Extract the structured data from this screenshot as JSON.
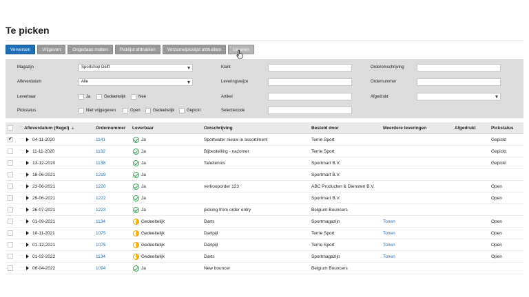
{
  "page": {
    "title": "Te picken"
  },
  "toolbar": {
    "buttons": [
      {
        "label": "Verversen"
      },
      {
        "label": "Vrijgeven"
      },
      {
        "label": "Ongedaan maken"
      },
      {
        "label": "Picklijst afdrukken"
      },
      {
        "label": "Verzamelpicklijst afdrukken"
      },
      {
        "label": "Leveren"
      }
    ]
  },
  "filters": {
    "magazijn": {
      "label": "Magazijn",
      "value": "Sportshop Delft"
    },
    "afleverdatum": {
      "label": "Afleverdatum",
      "value": "Alle"
    },
    "leverbaar": {
      "label": "Leverbaar",
      "options": [
        "Ja",
        "Gedeeltelijk",
        "Nee"
      ]
    },
    "pickstatus": {
      "label": "Pickstatus",
      "options": [
        "Niet vrijgegeven",
        "Open",
        "Gedeeltelijk",
        "Gepickt"
      ]
    },
    "klant": {
      "label": "Klant",
      "value": ""
    },
    "leveringswijze": {
      "label": "Leveringswijze",
      "value": ""
    },
    "artikel": {
      "label": "Artikel",
      "value": ""
    },
    "selectiecode": {
      "label": "Selectiecode",
      "value": ""
    },
    "orderomschrijving": {
      "label": "Orderomschrijving",
      "value": ""
    },
    "ordernummer": {
      "label": "Ordernummer",
      "value": ""
    },
    "afgedrukt": {
      "label": "Afgedrukt",
      "value": ""
    }
  },
  "table": {
    "headers": {
      "afleverdatum": "Afleverdatum (Regel)",
      "ordernummer": "Ordernummer",
      "leverbaar": "Leverbaar",
      "omschrijving": "Omschrijving",
      "besteld_door": "Besteld door",
      "meerdere_leveringen": "Meerdere leveringen",
      "afgedrukt": "Afgedrukt",
      "pickstatus": "Pickstatus"
    },
    "rows": [
      {
        "date": "04-11-2020",
        "order": "1141",
        "leverbaar": "Ja",
        "icon": "check-circle-icon",
        "omschrijving": "Sportwater nieuw in assortiment",
        "besteld": "Terrie Sport",
        "meerdere": "",
        "status": "Gepickt"
      },
      {
        "date": "11-11-2020",
        "order": "1132",
        "leverbaar": "Ja",
        "icon": "check-circle-icon",
        "omschrijving": "Bijbestelling - nazomer",
        "besteld": "Terrie Sport",
        "meerdere": "",
        "status": "Gepickt"
      },
      {
        "date": "13-12-2020",
        "order": "1138",
        "leverbaar": "Ja",
        "icon": "check-circle-icon",
        "omschrijving": "Tafeltennis",
        "besteld": "Sportmart B.V.",
        "meerdere": "",
        "status": "Gepickt"
      },
      {
        "date": "18-06-2021",
        "order": "1219",
        "leverbaar": "Ja",
        "icon": "check-circle-icon",
        "omschrijving": "",
        "besteld": "Sportmart B.V.",
        "meerdere": "",
        "status": ""
      },
      {
        "date": "23-06-2021",
        "order": "1220",
        "leverbaar": "Ja",
        "icon": "check-circle-icon",
        "omschrijving": "verkooporder 123",
        "besteld": "ABC Producten & Diensten B.V.",
        "meerdere": "",
        "status": "Open"
      },
      {
        "date": "29-06-2021",
        "order": "1222",
        "leverbaar": "Ja",
        "icon": "check-circle-icon",
        "omschrijving": "",
        "besteld": "Sportmart B.V.",
        "meerdere": "",
        "status": "Open"
      },
      {
        "date": "26-07-2021",
        "order": "1223",
        "leverbaar": "Ja",
        "icon": "check-circle-icon",
        "omschrijving": "picking from order entry",
        "besteld": "Belgium Bouncers",
        "meerdere": "",
        "status": ""
      },
      {
        "date": "01-09-2021",
        "order": "1134",
        "leverbaar": "Gedeeltelijk",
        "icon": "half-circle-icon",
        "omschrijving": "Darts",
        "besteld": "Sportmagazijn",
        "meerdere": "Tonen",
        "status": "Open"
      },
      {
        "date": "10-11-2021",
        "order": "1075",
        "leverbaar": "Gedeeltelijk",
        "icon": "half-circle-icon",
        "omschrijving": "Dartpijl",
        "besteld": "Terrie Sport",
        "meerdere": "Tonen",
        "status": "Open"
      },
      {
        "date": "01-12-2021",
        "order": "1075",
        "leverbaar": "Gedeeltelijk",
        "icon": "half-circle-icon",
        "omschrijving": "Dartpijl",
        "besteld": "Terrie Sport",
        "meerdere": "Tonen",
        "status": "Open"
      },
      {
        "date": "01-02-2022",
        "order": "1134",
        "leverbaar": "Gedeeltelijk",
        "icon": "half-circle-icon",
        "omschrijving": "Darts",
        "besteld": "Sportmagazijn",
        "meerdere": "Tonen",
        "status": "Open"
      },
      {
        "date": "06-04-2022",
        "order": "1094",
        "leverbaar": "Ja",
        "icon": "check-circle-icon",
        "omschrijving": "New bouncer",
        "besteld": "Belgium Bouncers",
        "meerdere": "",
        "status": ""
      }
    ]
  },
  "colors": {
    "primary": "#1f6db5",
    "button_grey": "#9a9a9a",
    "panel": "#dcdcdc",
    "ok": "#2aa24a",
    "partial": "#f3b300"
  }
}
